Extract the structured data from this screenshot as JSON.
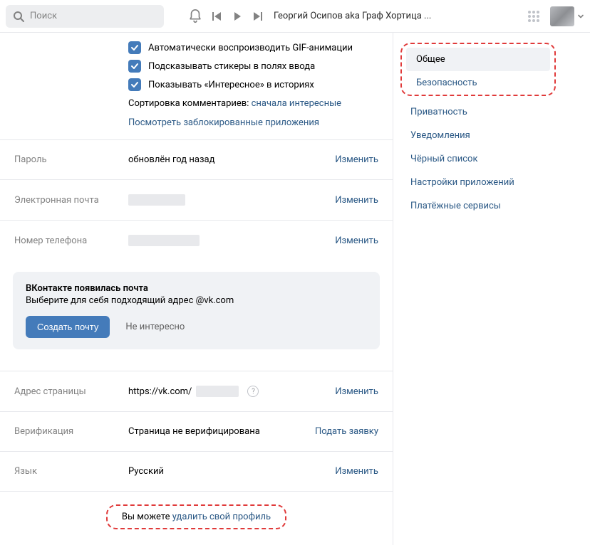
{
  "topbar": {
    "search_placeholder": "Поиск",
    "track_title": "Георгий Осипов aka Граф Хортица ..."
  },
  "checkboxes": {
    "gif": "Автоматически воспроизводить GIF-анимации",
    "stickers": "Подсказывать стикеры в полях ввода",
    "interesting": "Показывать «Интересное» в историях"
  },
  "comments_sort": {
    "label": "Сортировка комментариев: ",
    "value": "сначала интересные"
  },
  "blocked_apps_link": "Посмотреть заблокированные приложения",
  "rows": {
    "password": {
      "label": "Пароль",
      "value": "обновлён год назад",
      "action": "Изменить"
    },
    "email": {
      "label": "Электронная почта",
      "action": "Изменить"
    },
    "phone": {
      "label": "Номер телефона",
      "action": "Изменить"
    },
    "address": {
      "label": "Адрес страницы",
      "prefix": "https://vk.com/",
      "action": "Изменить"
    },
    "verification": {
      "label": "Верификация",
      "value": "Страница не верифицирована",
      "action": "Подать заявку"
    },
    "language": {
      "label": "Язык",
      "value": "Русский",
      "action": "Изменить"
    }
  },
  "mail_promo": {
    "title": "ВКонтакте появилась почта",
    "sub": "Выберите для себя подходящий адрес @vk.com",
    "create": "Создать почту",
    "dismiss": "Не интересно"
  },
  "delete": {
    "pre": "Вы можете ",
    "link": "удалить свой профиль"
  },
  "sidebar": {
    "items": [
      "Общее",
      "Безопасность",
      "Приватность",
      "Уведомления",
      "Чёрный список",
      "Настройки приложений",
      "Платёжные сервисы"
    ]
  }
}
